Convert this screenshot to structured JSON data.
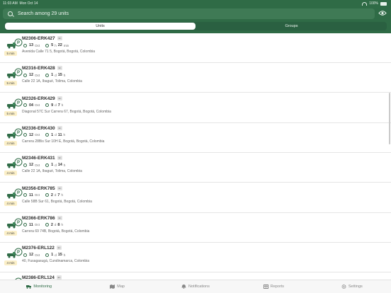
{
  "status_bar": {
    "time": "11:03 AM",
    "date": "Mon Oct 14",
    "battery": "100%"
  },
  "search": {
    "placeholder": "Search among 29 units",
    "icon": "search-icon"
  },
  "visibility_icon": "eye-icon",
  "segments": [
    {
      "label": "Units",
      "active": true
    },
    {
      "label": "Groups",
      "active": false
    }
  ],
  "units": [
    {
      "name": "M2306-ERK427",
      "tag": "En",
      "badge": "5 min",
      "date_day": "13",
      "date_month": "Oct",
      "duration_a": "5",
      "duration_a_unit": "h",
      "duration_b": "22",
      "duration_b_unit": "min",
      "address": "Avenida Calle 71 5, Bogotá, Bogotá, Colombia"
    },
    {
      "name": "M2316-ERK428",
      "tag": "En",
      "badge": "5 min",
      "date_day": "12",
      "date_month": "Oct",
      "duration_a": "1",
      "duration_a_unit": "d",
      "duration_b": "15",
      "duration_b_unit": "h",
      "address": "Calle 22 1A, Ibagué, Tolima, Colombia"
    },
    {
      "name": "M2326-ERK429",
      "tag": "En",
      "badge": "5 min",
      "date_day": "04",
      "date_month": "Oct",
      "duration_a": "9",
      "duration_a_unit": "d",
      "duration_b": "7",
      "duration_b_unit": "h",
      "address": "Diagonal 57C Sur Carrera 67, Bogotá, Bogotá, Colombia"
    },
    {
      "name": "M2336-ERK430",
      "tag": "En",
      "badge": "4 min",
      "date_day": "12",
      "date_month": "Oct",
      "duration_a": "1",
      "duration_a_unit": "d",
      "duration_b": "11",
      "duration_b_unit": "h",
      "address": "Carrera 28Bis Sur 10H E, Bogotá, Bogotá, Colombia"
    },
    {
      "name": "M2346-ERK431",
      "tag": "En",
      "badge": "4 min",
      "date_day": "12",
      "date_month": "Oct",
      "duration_a": "1",
      "duration_a_unit": "d",
      "duration_b": "14",
      "duration_b_unit": "h",
      "address": "Calle 22 1A, Ibagué, Tolima, Colombia"
    },
    {
      "name": "M2356-ERK785",
      "tag": "En",
      "badge": "4 min",
      "date_day": "11",
      "date_month": "Oct",
      "duration_a": "2",
      "duration_a_unit": "d",
      "duration_b": "7",
      "duration_b_unit": "h",
      "address": "Calle 58B Sur 61, Bogotá, Bogotá, Colombia"
    },
    {
      "name": "M2366-ERK786",
      "tag": "En",
      "badge": "4 min",
      "date_day": "11",
      "date_month": "Oct",
      "duration_a": "2",
      "duration_a_unit": "d",
      "duration_b": "8",
      "duration_b_unit": "h",
      "address": "Carrera 69 74B, Bogotá, Bogotá, Colombia"
    },
    {
      "name": "M2376-ERL122",
      "tag": "En",
      "badge": "4 min",
      "date_day": "12",
      "date_month": "Oct",
      "duration_a": "1",
      "duration_a_unit": "d",
      "duration_b": "15",
      "duration_b_unit": "h",
      "address": "40, Fusagasugá, Cundinamarca, Colombia"
    },
    {
      "name": "M2386-ERL124",
      "tag": "En",
      "badge": "",
      "date_day": "",
      "date_month": "",
      "duration_a": "",
      "duration_a_unit": "",
      "duration_b": "",
      "duration_b_unit": "",
      "address": ""
    }
  ],
  "tabs": [
    {
      "label": "Monitoring",
      "icon": "truck-icon",
      "active": true
    },
    {
      "label": "Map",
      "icon": "map-icon",
      "active": false
    },
    {
      "label": "Notifications",
      "icon": "bell-icon",
      "active": false
    },
    {
      "label": "Reports",
      "icon": "report-icon",
      "active": false
    },
    {
      "label": "Settings",
      "icon": "gear-icon",
      "active": false
    }
  ],
  "colors": {
    "header": "#2f6b46",
    "accent": "#2f6b46",
    "badge_bg": "#fbefc7"
  }
}
